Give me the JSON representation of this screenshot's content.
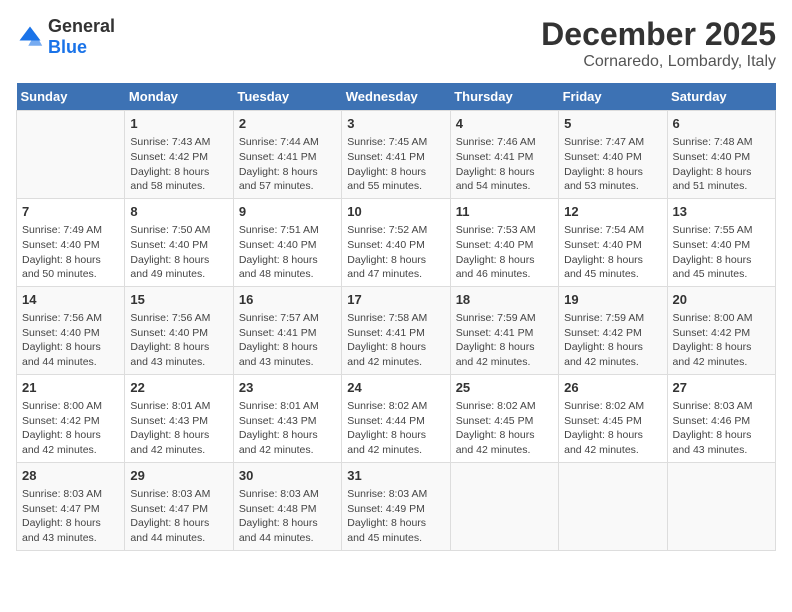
{
  "logo": {
    "text_general": "General",
    "text_blue": "Blue"
  },
  "title": "December 2025",
  "subtitle": "Cornaredo, Lombardy, Italy",
  "days_of_week": [
    "Sunday",
    "Monday",
    "Tuesday",
    "Wednesday",
    "Thursday",
    "Friday",
    "Saturday"
  ],
  "weeks": [
    [
      {
        "day": "",
        "content": ""
      },
      {
        "day": "1",
        "content": "Sunrise: 7:43 AM\nSunset: 4:42 PM\nDaylight: 8 hours\nand 58 minutes."
      },
      {
        "day": "2",
        "content": "Sunrise: 7:44 AM\nSunset: 4:41 PM\nDaylight: 8 hours\nand 57 minutes."
      },
      {
        "day": "3",
        "content": "Sunrise: 7:45 AM\nSunset: 4:41 PM\nDaylight: 8 hours\nand 55 minutes."
      },
      {
        "day": "4",
        "content": "Sunrise: 7:46 AM\nSunset: 4:41 PM\nDaylight: 8 hours\nand 54 minutes."
      },
      {
        "day": "5",
        "content": "Sunrise: 7:47 AM\nSunset: 4:40 PM\nDaylight: 8 hours\nand 53 minutes."
      },
      {
        "day": "6",
        "content": "Sunrise: 7:48 AM\nSunset: 4:40 PM\nDaylight: 8 hours\nand 51 minutes."
      }
    ],
    [
      {
        "day": "7",
        "content": "Sunrise: 7:49 AM\nSunset: 4:40 PM\nDaylight: 8 hours\nand 50 minutes."
      },
      {
        "day": "8",
        "content": "Sunrise: 7:50 AM\nSunset: 4:40 PM\nDaylight: 8 hours\nand 49 minutes."
      },
      {
        "day": "9",
        "content": "Sunrise: 7:51 AM\nSunset: 4:40 PM\nDaylight: 8 hours\nand 48 minutes."
      },
      {
        "day": "10",
        "content": "Sunrise: 7:52 AM\nSunset: 4:40 PM\nDaylight: 8 hours\nand 47 minutes."
      },
      {
        "day": "11",
        "content": "Sunrise: 7:53 AM\nSunset: 4:40 PM\nDaylight: 8 hours\nand 46 minutes."
      },
      {
        "day": "12",
        "content": "Sunrise: 7:54 AM\nSunset: 4:40 PM\nDaylight: 8 hours\nand 45 minutes."
      },
      {
        "day": "13",
        "content": "Sunrise: 7:55 AM\nSunset: 4:40 PM\nDaylight: 8 hours\nand 45 minutes."
      }
    ],
    [
      {
        "day": "14",
        "content": "Sunrise: 7:56 AM\nSunset: 4:40 PM\nDaylight: 8 hours\nand 44 minutes."
      },
      {
        "day": "15",
        "content": "Sunrise: 7:56 AM\nSunset: 4:40 PM\nDaylight: 8 hours\nand 43 minutes."
      },
      {
        "day": "16",
        "content": "Sunrise: 7:57 AM\nSunset: 4:41 PM\nDaylight: 8 hours\nand 43 minutes."
      },
      {
        "day": "17",
        "content": "Sunrise: 7:58 AM\nSunset: 4:41 PM\nDaylight: 8 hours\nand 42 minutes."
      },
      {
        "day": "18",
        "content": "Sunrise: 7:59 AM\nSunset: 4:41 PM\nDaylight: 8 hours\nand 42 minutes."
      },
      {
        "day": "19",
        "content": "Sunrise: 7:59 AM\nSunset: 4:42 PM\nDaylight: 8 hours\nand 42 minutes."
      },
      {
        "day": "20",
        "content": "Sunrise: 8:00 AM\nSunset: 4:42 PM\nDaylight: 8 hours\nand 42 minutes."
      }
    ],
    [
      {
        "day": "21",
        "content": "Sunrise: 8:00 AM\nSunset: 4:42 PM\nDaylight: 8 hours\nand 42 minutes."
      },
      {
        "day": "22",
        "content": "Sunrise: 8:01 AM\nSunset: 4:43 PM\nDaylight: 8 hours\nand 42 minutes."
      },
      {
        "day": "23",
        "content": "Sunrise: 8:01 AM\nSunset: 4:43 PM\nDaylight: 8 hours\nand 42 minutes."
      },
      {
        "day": "24",
        "content": "Sunrise: 8:02 AM\nSunset: 4:44 PM\nDaylight: 8 hours\nand 42 minutes."
      },
      {
        "day": "25",
        "content": "Sunrise: 8:02 AM\nSunset: 4:45 PM\nDaylight: 8 hours\nand 42 minutes."
      },
      {
        "day": "26",
        "content": "Sunrise: 8:02 AM\nSunset: 4:45 PM\nDaylight: 8 hours\nand 42 minutes."
      },
      {
        "day": "27",
        "content": "Sunrise: 8:03 AM\nSunset: 4:46 PM\nDaylight: 8 hours\nand 43 minutes."
      }
    ],
    [
      {
        "day": "28",
        "content": "Sunrise: 8:03 AM\nSunset: 4:47 PM\nDaylight: 8 hours\nand 43 minutes."
      },
      {
        "day": "29",
        "content": "Sunrise: 8:03 AM\nSunset: 4:47 PM\nDaylight: 8 hours\nand 44 minutes."
      },
      {
        "day": "30",
        "content": "Sunrise: 8:03 AM\nSunset: 4:48 PM\nDaylight: 8 hours\nand 44 minutes."
      },
      {
        "day": "31",
        "content": "Sunrise: 8:03 AM\nSunset: 4:49 PM\nDaylight: 8 hours\nand 45 minutes."
      },
      {
        "day": "",
        "content": ""
      },
      {
        "day": "",
        "content": ""
      },
      {
        "day": "",
        "content": ""
      }
    ]
  ]
}
